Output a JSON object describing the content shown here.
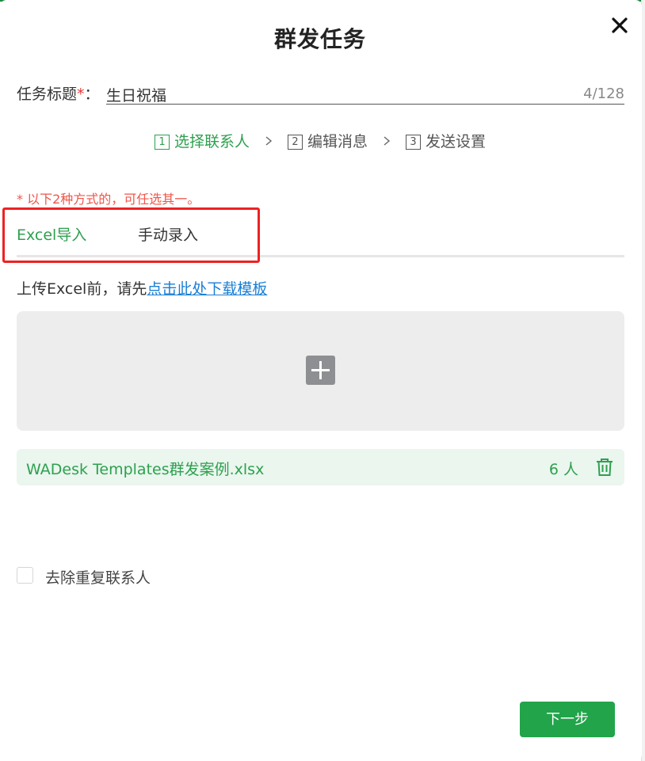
{
  "dialog": {
    "title": "群发任务",
    "close_icon": "close-icon"
  },
  "task": {
    "label": "任务标题",
    "required_mark": "*",
    "colon": "：",
    "value": "生日祝福",
    "counter": "4/128"
  },
  "steps": [
    {
      "num": "1",
      "label": "选择联系人",
      "active": true
    },
    {
      "num": "2",
      "label": "编辑消息",
      "active": false
    },
    {
      "num": "3",
      "label": "发送设置",
      "active": false
    }
  ],
  "hint": "* 以下2种方式的，可任选其一。",
  "tabs": [
    {
      "label": "Excel导入",
      "active": true
    },
    {
      "label": "手动录入",
      "active": false
    }
  ],
  "upload": {
    "prefix": "上传Excel前，请先",
    "link": "点击此处下载模板",
    "icon": "plus-icon"
  },
  "file": {
    "name": "WADesk Templates群发案例.xlsx",
    "count": "6 人",
    "icon": "trash-icon"
  },
  "dedupe": {
    "label": "去除重复联系人",
    "checked": false
  },
  "footer": {
    "next_label": "下一步"
  },
  "colors": {
    "accent": "#2ea04f",
    "button": "#22a44a",
    "link": "#1a7fd4",
    "warning": "#f0554a",
    "highlight": "#ee2222"
  }
}
